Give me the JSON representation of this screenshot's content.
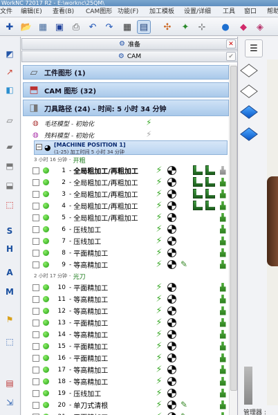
{
  "window": {
    "title": "WorkNC 72017 R2 - E:\\worknc\\25QM\\"
  },
  "menu": [
    "文件",
    "编辑(E)",
    "查看(B)",
    "CAM图形",
    "功能(F)",
    "加工模板",
    "设置/详细",
    "工具",
    "窗口",
    "帮助"
  ],
  "stages": {
    "prepare": "准备",
    "cam": "CAM",
    "close_label": "✕",
    "ok_label": "✔"
  },
  "groups": {
    "work_graphics": "工件图形 (1)",
    "cam_graphics": "CAM 图形 (32)",
    "toolpaths": "刀具路径 (24) - 时间: 5 小时 34 分钟"
  },
  "models": {
    "stock": "毛坯模型 - 初始化",
    "residual": "残料模型 - 初始化"
  },
  "machine": {
    "title": "[MACHINE POSITION 1]",
    "summary": "(1-25) 加工时间 5 小时 34 分钟"
  },
  "sections": [
    {
      "time": "3 小时 16 分钟",
      "dash": "-",
      "name": "开粗"
    },
    {
      "time": "2 小时 17 分钟",
      "dash": "-",
      "name": "光刀"
    }
  ],
  "rows": [
    {
      "n": "1",
      "name": "全局粗加工/再粗加工",
      "bold": true,
      "extra": "L"
    },
    {
      "n": "2",
      "name": "全局粗加工/再粗加工",
      "extra": "L"
    },
    {
      "n": "3",
      "name": "全局粗加工/再粗加工",
      "extra": "L"
    },
    {
      "n": "4",
      "name": "全局粗加工/再粗加工",
      "extra": "L"
    },
    {
      "n": "5",
      "name": "全局粗加工/再粗加工",
      "extra": ""
    },
    {
      "n": "6",
      "name": "压线加工",
      "extra": ""
    },
    {
      "n": "7",
      "name": "压线加工",
      "extra": ""
    },
    {
      "n": "8",
      "name": "平面精加工",
      "extra": ""
    },
    {
      "n": "9",
      "name": "等高精加工",
      "extra": "P"
    },
    {
      "n": "10",
      "name": "平面精加工",
      "extra": ""
    },
    {
      "n": "11",
      "name": "等高精加工",
      "extra": ""
    },
    {
      "n": "12",
      "name": "等高精加工",
      "extra": ""
    },
    {
      "n": "13",
      "name": "平面精加工",
      "extra": ""
    },
    {
      "n": "14",
      "name": "等高精加工",
      "extra": ""
    },
    {
      "n": "15",
      "name": "平面精加工",
      "extra": ""
    },
    {
      "n": "16",
      "name": "平面精加工",
      "extra": ""
    },
    {
      "n": "17",
      "name": "等高精加工",
      "extra": ""
    },
    {
      "n": "18",
      "name": "等高精加工",
      "extra": ""
    },
    {
      "n": "19",
      "name": "压线加工",
      "extra": ""
    },
    {
      "n": "20",
      "name": "单刀式清根",
      "extra": "P"
    },
    {
      "n": "21",
      "name": "平面精加工",
      "extra": "P"
    }
  ],
  "status": {
    "manager": "管理器 :"
  },
  "colors": {
    "active": "#3caa2a",
    "header": "#a9c9ea"
  }
}
